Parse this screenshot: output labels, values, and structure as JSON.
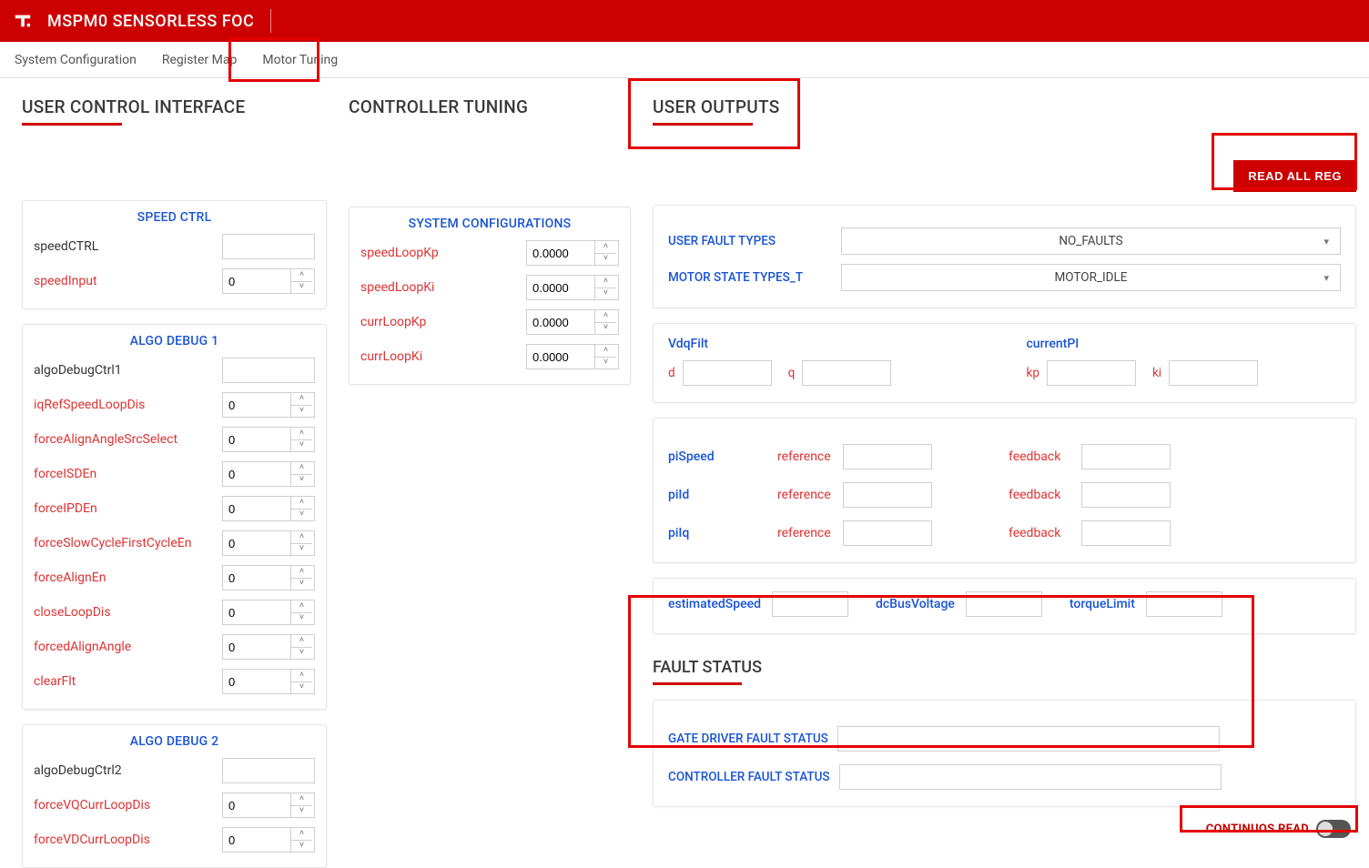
{
  "app_title": "MSPM0 SENSORLESS FOC",
  "tabs": [
    "System Configuration",
    "Register Map",
    "Motor Tuning"
  ],
  "sections": {
    "user_ctrl": "USER CONTROL INTERFACE",
    "ctrl_tune": "CONTROLLER TUNING",
    "user_out": "USER OUTPUTS",
    "fault_status": "FAULT STATUS"
  },
  "speed_ctrl": {
    "title": "SPEED CTRL",
    "speedCTRL_lbl": "speedCTRL",
    "speedInput_lbl": "speedInput",
    "speedInput_val": "0"
  },
  "algo1": {
    "title": "ALGO DEBUG 1",
    "ctrl_lbl": "algoDebugCtrl1",
    "rows": [
      {
        "lbl": "iqRefSpeedLoopDis",
        "val": "0"
      },
      {
        "lbl": "forceAlignAngleSrcSelect",
        "val": "0"
      },
      {
        "lbl": "forceISDEn",
        "val": "0"
      },
      {
        "lbl": "forceIPDEn",
        "val": "0"
      },
      {
        "lbl": "forceSlowCycleFirstCycleEn",
        "val": "0"
      },
      {
        "lbl": "forceAlignEn",
        "val": "0"
      },
      {
        "lbl": "closeLoopDis",
        "val": "0"
      },
      {
        "lbl": "forcedAlignAngle",
        "val": "0"
      },
      {
        "lbl": "clearFlt",
        "val": "0"
      }
    ]
  },
  "algo2": {
    "title": "ALGO DEBUG 2",
    "ctrl_lbl": "algoDebugCtrl2",
    "rows": [
      {
        "lbl": "forceVQCurrLoopDis",
        "val": "0"
      },
      {
        "lbl": "forceVDCurrLoopDis",
        "val": "0"
      }
    ]
  },
  "sysconf": {
    "title": "SYSTEM CONFIGURATIONS",
    "rows": [
      {
        "lbl": "speedLoopKp",
        "val": "0.0000"
      },
      {
        "lbl": "speedLoopKi",
        "val": "0.0000"
      },
      {
        "lbl": "currLoopKp",
        "val": "0.0000"
      },
      {
        "lbl": "currLoopKi",
        "val": "0.0000"
      }
    ]
  },
  "read_all_btn": "READ ALL REG",
  "out_sel": [
    {
      "lbl": "USER FAULT TYPES",
      "val": "NO_FAULTS"
    },
    {
      "lbl": "MOTOR STATE TYPES_T",
      "val": "MOTOR_IDLE"
    }
  ],
  "vdq": {
    "title": "VdqFilt",
    "d": "d",
    "q": "q"
  },
  "cpi": {
    "title": "currentPI",
    "kp": "kp",
    "ki": "ki"
  },
  "pis": [
    {
      "name": "piSpeed",
      "ref": "reference",
      "fb": "feedback"
    },
    {
      "name": "piId",
      "ref": "reference",
      "fb": "feedback"
    },
    {
      "name": "piIq",
      "ref": "reference",
      "fb": "feedback"
    }
  ],
  "est": {
    "estimatedSpeed": "estimatedSpeed",
    "dcBusVoltage": "dcBusVoltage",
    "torqueLimit": "torqueLimit"
  },
  "gate_driver_fault_lbl": "GATE DRIVER FAULT STATUS",
  "controller_fault_lbl": "CONTROLLER FAULT STATUS",
  "cont_read": "CONTINUOS READ"
}
